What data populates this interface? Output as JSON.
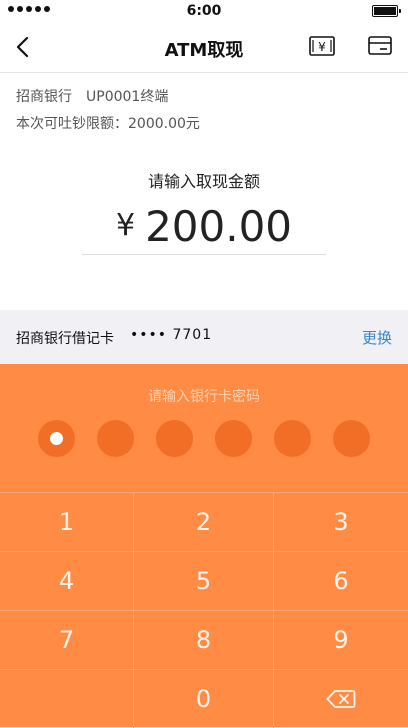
{
  "status_bar": {
    "time": "6:00"
  },
  "header": {
    "title": "ATM取现"
  },
  "info": {
    "bank": "招商银行",
    "terminal": "UP0001终端",
    "limit": "本次可吐钞限额：2000.00元"
  },
  "amount": {
    "prompt": "请输入取现金额",
    "currency": "¥",
    "value": "200.00"
  },
  "card": {
    "name": "招商银行借记卡",
    "number": "•••• 7701",
    "change_label": "更换"
  },
  "keypad": {
    "prompt": "请输入银行卡密码",
    "pin_total": 6,
    "pin_entered": 1,
    "keys": [
      "1",
      "2",
      "3",
      "4",
      "5",
      "6",
      "7",
      "8",
      "9",
      "",
      "0",
      "delete"
    ]
  },
  "colors": {
    "accent": "#ff8b44",
    "pin_dot": "#f26e26",
    "link": "#3a86c8"
  },
  "icons": {
    "back": "chevron-left-icon",
    "cash": "cash-yen-icon",
    "card": "card-icon",
    "delete": "backspace-icon"
  }
}
